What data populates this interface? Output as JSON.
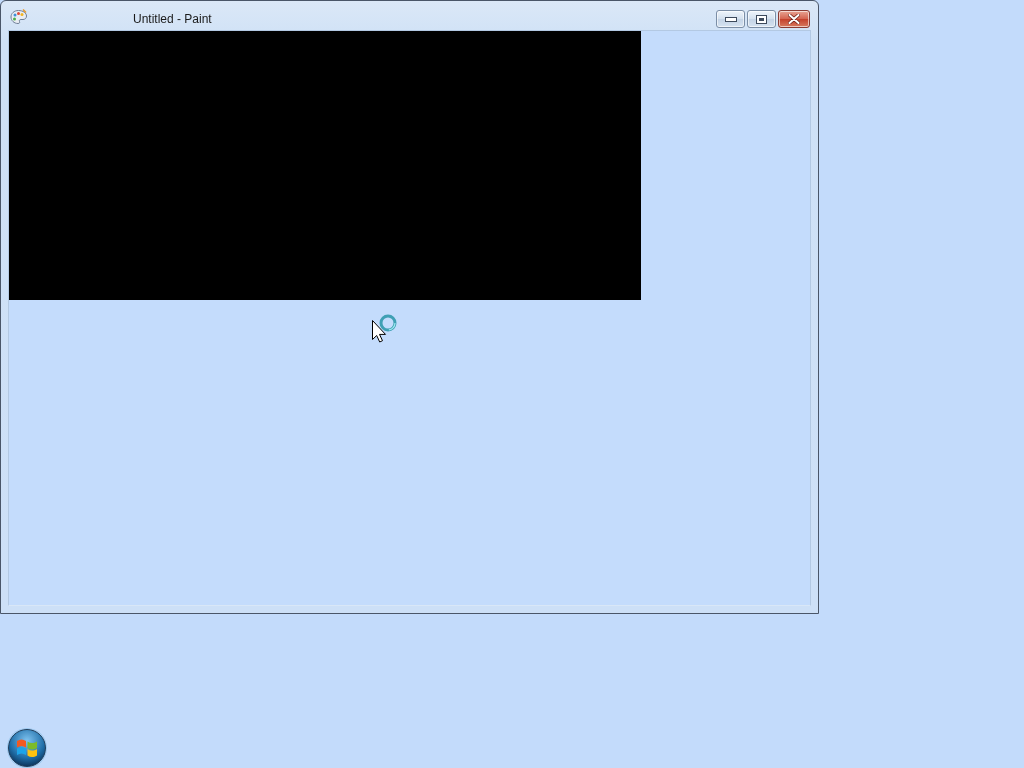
{
  "window": {
    "title": "Untitled - Paint"
  }
}
